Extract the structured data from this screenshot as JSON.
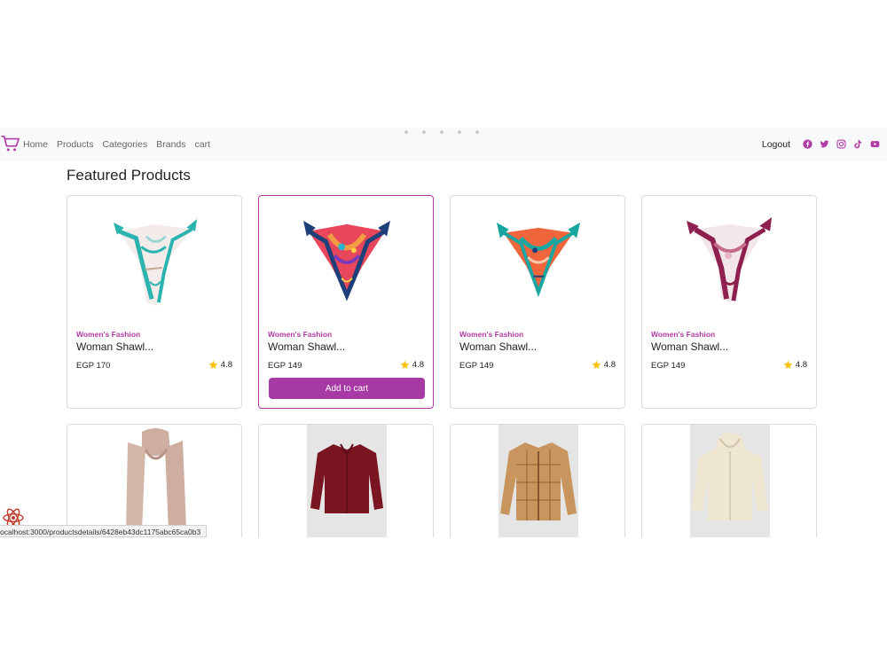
{
  "nav": {
    "links": [
      "Home",
      "Products",
      "Categories",
      "Brands",
      "cart"
    ],
    "logout": "Logout",
    "social_icons": [
      "facebook-icon",
      "twitter-icon",
      "instagram-icon",
      "tiktok-icon",
      "youtube-icon"
    ],
    "accent_color": "#b03aa6"
  },
  "section": {
    "title": "Featured Products"
  },
  "products": [
    {
      "category": "Women's Fashion",
      "name": "Woman Shawl...",
      "price": "EGP 170",
      "rating": "4.8"
    },
    {
      "category": "Women's Fashion",
      "name": "Woman Shawl...",
      "price": "EGP 149",
      "rating": "4.8",
      "button": "Add to cart"
    },
    {
      "category": "Women's Fashion",
      "name": "Woman Shawl...",
      "price": "EGP 149",
      "rating": "4.8"
    },
    {
      "category": "Women's Fashion",
      "name": "Woman Shawl...",
      "price": "EGP 149",
      "rating": "4.8"
    }
  ],
  "status_bar": {
    "url": "ocalhost:3000/productsdetails/6428eb43dc1175abc65ca0b3"
  }
}
